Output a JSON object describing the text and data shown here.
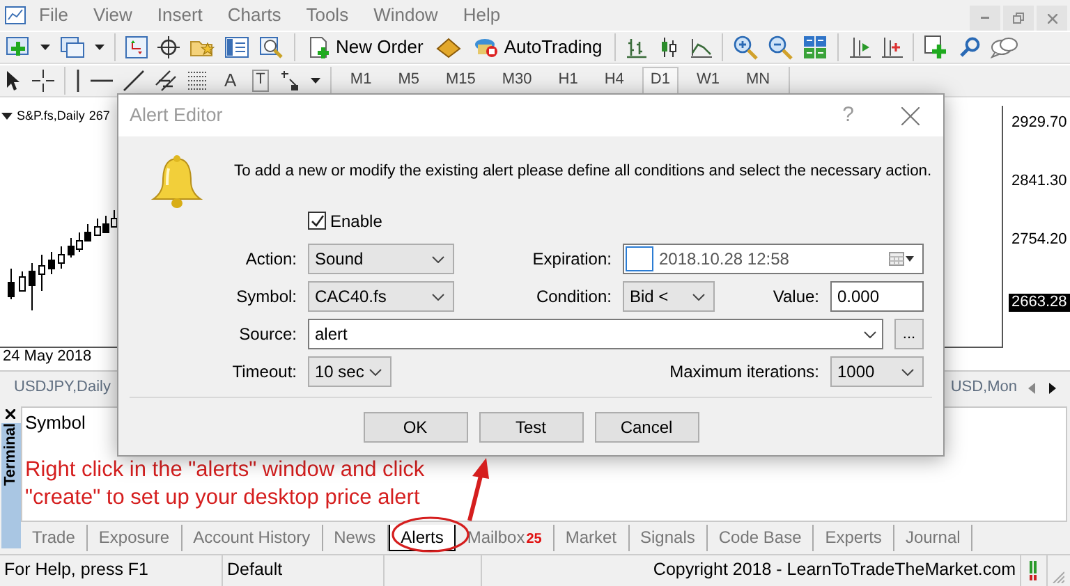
{
  "menu": [
    "File",
    "View",
    "Insert",
    "Charts",
    "Tools",
    "Window",
    "Help"
  ],
  "toolbar": {
    "new_order": "New Order",
    "autotrading": "AutoTrading"
  },
  "drawing_tools": {
    "text_tool": "A",
    "label_tool": "T"
  },
  "timeframes": [
    {
      "label": "M1",
      "selected": false
    },
    {
      "label": "M5",
      "selected": false
    },
    {
      "label": "M15",
      "selected": false
    },
    {
      "label": "M30",
      "selected": false
    },
    {
      "label": "H1",
      "selected": false
    },
    {
      "label": "H4",
      "selected": false
    },
    {
      "label": "D1",
      "selected": true
    },
    {
      "label": "W1",
      "selected": false
    },
    {
      "label": "MN",
      "selected": false
    }
  ],
  "chart": {
    "title": "S&P.fs,Daily",
    "price": "267",
    "axis_labels": [
      "2929.70",
      "2841.30",
      "2754.20"
    ],
    "current_price": "2663.28",
    "date": "24 May 2018"
  },
  "chart_tabs": [
    "USDJPY,Daily",
    "USD,Mon"
  ],
  "terminal": {
    "title": "Terminal",
    "column": "Symbol",
    "tabs": [
      {
        "label": "Trade",
        "selected": false
      },
      {
        "label": "Exposure",
        "selected": false
      },
      {
        "label": "Account History",
        "selected": false
      },
      {
        "label": "News",
        "selected": false
      },
      {
        "label": "Alerts",
        "selected": true
      },
      {
        "label": "Mailbox",
        "selected": false,
        "badge": "25"
      },
      {
        "label": "Market",
        "selected": false
      },
      {
        "label": "Signals",
        "selected": false
      },
      {
        "label": "Code Base",
        "selected": false
      },
      {
        "label": "Experts",
        "selected": false
      },
      {
        "label": "Journal",
        "selected": false
      }
    ]
  },
  "annotation": "Right click in the \"alerts\" window and click \"create\" to set up your desktop price alert",
  "status_bar": [
    "For Help, press F1",
    "Default",
    "Copyright 2018 - LearnToTradeTheMarket.com"
  ],
  "dialog": {
    "title": "Alert Editor",
    "help": "?",
    "message": "To add a new or modify the existing alert please define all conditions and select the necessary action.",
    "enable": {
      "label": "Enable",
      "checked": true
    },
    "action": {
      "label": "Action:",
      "value": "Sound"
    },
    "expiration": {
      "label": "Expiration:",
      "checked": false,
      "value": "2018.10.28 12:58"
    },
    "symbol": {
      "label": "Symbol:",
      "value": "CAC40.fs"
    },
    "condition": {
      "label": "Condition:",
      "value": "Bid <"
    },
    "value": {
      "label": "Value:",
      "value": "0.000"
    },
    "source": {
      "label": "Source:",
      "value": "alert",
      "browse": "..."
    },
    "timeout": {
      "label": "Timeout:",
      "value": "10 sec"
    },
    "max_iterations": {
      "label": "Maximum iterations:",
      "value": "1000"
    },
    "buttons": [
      "OK",
      "Test",
      "Cancel"
    ]
  }
}
